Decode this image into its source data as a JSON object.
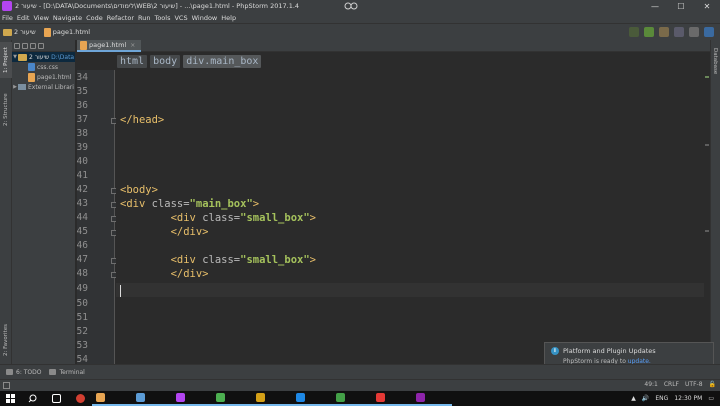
{
  "window": {
    "title": "שיעור 2 - [D:\\DATA\\Documents\\לימודים\\WEB\\2 שיעור] - ...\\page1.html - PhpStorm 2017.1.4",
    "controls": {
      "minimize": "—",
      "maximize": "☐",
      "close": "✕"
    }
  },
  "menu": [
    "File",
    "Edit",
    "View",
    "Navigate",
    "Code",
    "Refactor",
    "Run",
    "Tools",
    "VCS",
    "Window",
    "Help"
  ],
  "toolbar": {
    "project": "שיעור 2",
    "file": "page1.html"
  },
  "left_stripe": {
    "project_tab": "1: Project",
    "structure_tab": "2: Structure",
    "favorites_tab": "2: Favorites"
  },
  "right_stripe": {
    "database_tab": "Database"
  },
  "project_tree": {
    "root": {
      "name": "שיעור 2",
      "path": "D:\\Data"
    },
    "items": [
      "css.css",
      "page1.html"
    ],
    "external": "External Librari"
  },
  "editor": {
    "tab_label": "page1.html",
    "tab_close": "×",
    "breadcrumbs": [
      "html",
      "body",
      "div.main_box"
    ],
    "line_numbers": [
      34,
      35,
      36,
      37,
      38,
      39,
      40,
      41,
      42,
      43,
      44,
      45,
      46,
      47,
      48,
      49,
      50,
      51,
      52,
      53,
      54
    ],
    "lines": {
      "l37": "</head>",
      "l42": "<body>",
      "l43_tag": "<div ",
      "l43_attr": "class=",
      "l43_str": "\"main_box\"",
      "l43_end": ">",
      "l44_indent": "        ",
      "l44_tag": "<div ",
      "l44_attr": "class=",
      "l44_str": "\"small_box\"",
      "l44_end": ">",
      "l45": "        </div>",
      "l47_indent": "        ",
      "l47_tag": "<div ",
      "l47_attr": "class=",
      "l47_str": "\"small_box\"",
      "l47_end": ">",
      "l48": "        </div>"
    }
  },
  "notification": {
    "title": "Platform and Plugin Updates",
    "body": "PhpStorm is ready to ",
    "link": "update."
  },
  "bottom_tools": {
    "todo": "6: TODO",
    "terminal": "Terminal"
  },
  "status": {
    "position": "49:1",
    "line_sep": "CRLF",
    "encoding": "UTF-8"
  },
  "taskbar": {
    "lang": "ENG",
    "time": "12:30 PM"
  },
  "colors": {
    "background": "#2b2b2b",
    "tag": "#e8bf6a",
    "string": "#a5c25c",
    "link": "#589df6"
  }
}
